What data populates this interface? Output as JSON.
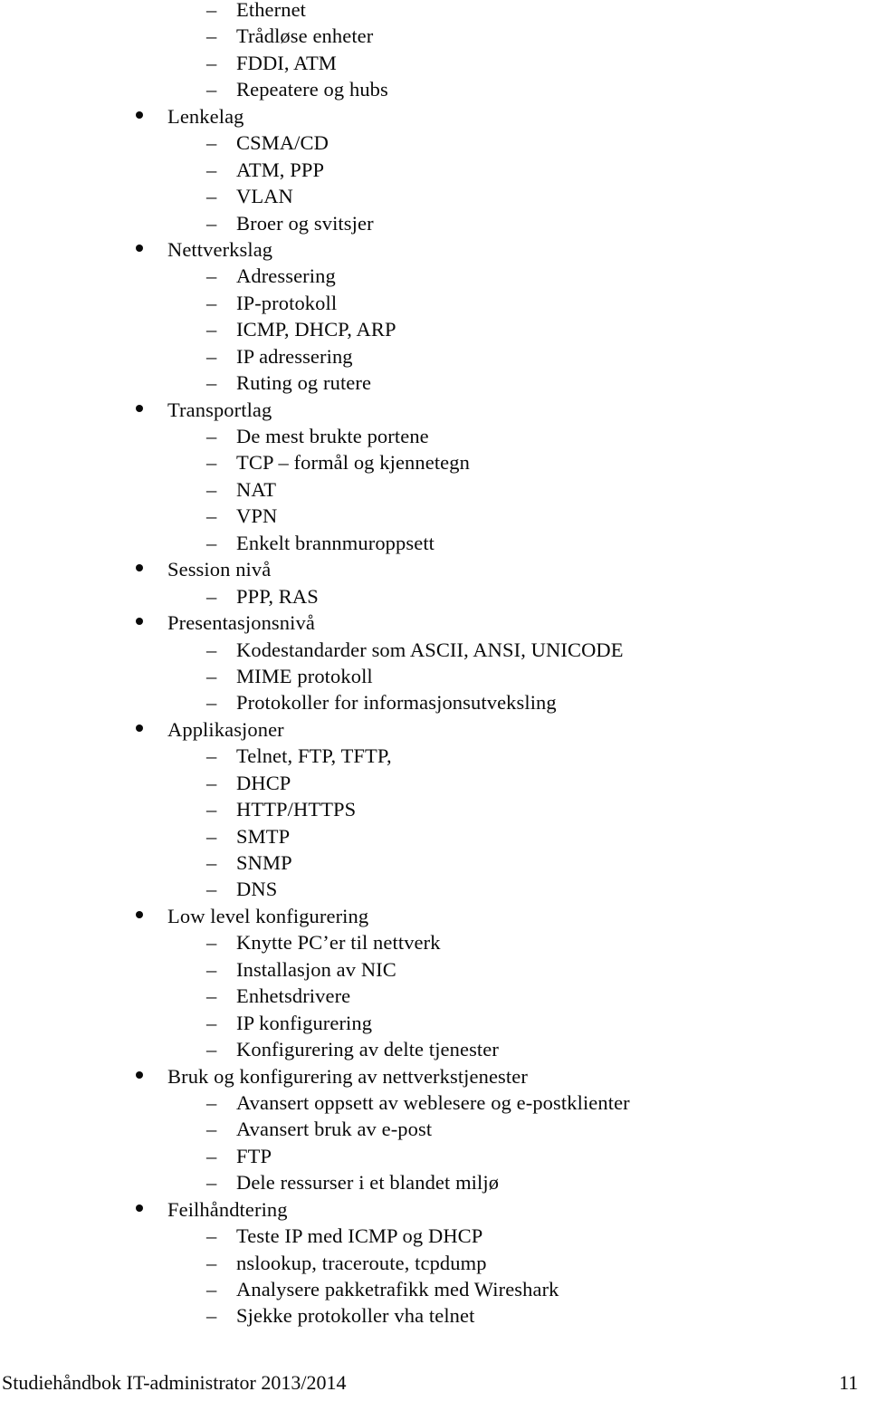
{
  "document": {
    "type": "study-handbook-outline-page",
    "language": "no",
    "page_number": "11"
  },
  "outline": {
    "items": [
      {
        "level": 2,
        "marker": "en-dash",
        "text": "Ethernet"
      },
      {
        "level": 2,
        "marker": "en-dash",
        "text": "Trådløse enheter"
      },
      {
        "level": 2,
        "marker": "en-dash",
        "text": "FDDI, ATM"
      },
      {
        "level": 2,
        "marker": "en-dash",
        "text": "Repeatere og hubs"
      },
      {
        "level": 1,
        "marker": "bullet",
        "text": "Lenkelag"
      },
      {
        "level": 2,
        "marker": "en-dash",
        "text": "CSMA/CD"
      },
      {
        "level": 2,
        "marker": "en-dash",
        "text": "ATM, PPP"
      },
      {
        "level": 2,
        "marker": "en-dash",
        "text": "VLAN"
      },
      {
        "level": 2,
        "marker": "en-dash",
        "text": "Broer og svitsjer"
      },
      {
        "level": 1,
        "marker": "bullet",
        "text": "Nettverkslag"
      },
      {
        "level": 2,
        "marker": "en-dash",
        "text": "Adressering"
      },
      {
        "level": 2,
        "marker": "en-dash",
        "text": "IP-protokoll"
      },
      {
        "level": 2,
        "marker": "en-dash",
        "text": "ICMP, DHCP, ARP"
      },
      {
        "level": 2,
        "marker": "en-dash",
        "text": "IP adressering"
      },
      {
        "level": 2,
        "marker": "en-dash",
        "text": "Ruting og rutere"
      },
      {
        "level": 1,
        "marker": "bullet",
        "text": "Transportlag"
      },
      {
        "level": 2,
        "marker": "en-dash",
        "text": "De mest brukte portene"
      },
      {
        "level": 2,
        "marker": "en-dash",
        "text": "TCP – formål og kjennetegn"
      },
      {
        "level": 2,
        "marker": "en-dash",
        "text": "NAT"
      },
      {
        "level": 2,
        "marker": "en-dash",
        "text": "VPN"
      },
      {
        "level": 2,
        "marker": "en-dash",
        "text": "Enkelt brannmuroppsett"
      },
      {
        "level": 1,
        "marker": "bullet",
        "text": "Session nivå"
      },
      {
        "level": 2,
        "marker": "en-dash",
        "text": "PPP, RAS"
      },
      {
        "level": 1,
        "marker": "bullet",
        "text": "Presentasjonsnivå"
      },
      {
        "level": 2,
        "marker": "en-dash",
        "text": "Kodestandarder som ASCII, ANSI, UNICODE"
      },
      {
        "level": 2,
        "marker": "en-dash",
        "text": "MIME protokoll"
      },
      {
        "level": 2,
        "marker": "en-dash",
        "text": "Protokoller for informasjonsutveksling"
      },
      {
        "level": 1,
        "marker": "bullet",
        "text": "Applikasjoner"
      },
      {
        "level": 2,
        "marker": "en-dash",
        "text": "Telnet, FTP, TFTP,"
      },
      {
        "level": 2,
        "marker": "en-dash",
        "text": "DHCP"
      },
      {
        "level": 2,
        "marker": "en-dash",
        "text": "HTTP/HTTPS"
      },
      {
        "level": 2,
        "marker": "en-dash",
        "text": "SMTP"
      },
      {
        "level": 2,
        "marker": "en-dash",
        "text": "SNMP"
      },
      {
        "level": 2,
        "marker": "en-dash",
        "text": "DNS"
      },
      {
        "level": 1,
        "marker": "bullet",
        "text": "Low level konfigurering"
      },
      {
        "level": 2,
        "marker": "en-dash",
        "text": "Knytte PC’er til nettverk"
      },
      {
        "level": 2,
        "marker": "en-dash",
        "text": "Installasjon av NIC"
      },
      {
        "level": 2,
        "marker": "en-dash",
        "text": "Enhetsdrivere"
      },
      {
        "level": 2,
        "marker": "en-dash",
        "text": "IP konfigurering"
      },
      {
        "level": 2,
        "marker": "en-dash",
        "text": "Konfigurering av delte tjenester"
      },
      {
        "level": 1,
        "marker": "bullet",
        "text": "Bruk og konfigurering av nettverkstjenester"
      },
      {
        "level": 2,
        "marker": "en-dash",
        "text": "Avansert oppsett av weblesere og e-postklienter"
      },
      {
        "level": 2,
        "marker": "en-dash",
        "text": "Avansert bruk av e-post"
      },
      {
        "level": 2,
        "marker": "en-dash",
        "text": "FTP"
      },
      {
        "level": 2,
        "marker": "en-dash",
        "text": "Dele ressurser i et blandet miljø"
      },
      {
        "level": 1,
        "marker": "bullet",
        "text": "Feilhåndtering"
      },
      {
        "level": 2,
        "marker": "en-dash",
        "text": "Teste IP med ICMP og DHCP"
      },
      {
        "level": 2,
        "marker": "en-dash",
        "text": "nslookup, traceroute, tcpdump"
      },
      {
        "level": 2,
        "marker": "en-dash",
        "text": "Analysere pakketrafikk med Wireshark"
      },
      {
        "level": 2,
        "marker": "en-dash",
        "text": "Sjekke protokoller vha telnet"
      }
    ]
  },
  "footer": {
    "text": "Studiehåndbok IT-administrator 2013/2014",
    "page": "11"
  },
  "colors": {
    "text": "#0a0a0a",
    "background": "#ffffff"
  }
}
